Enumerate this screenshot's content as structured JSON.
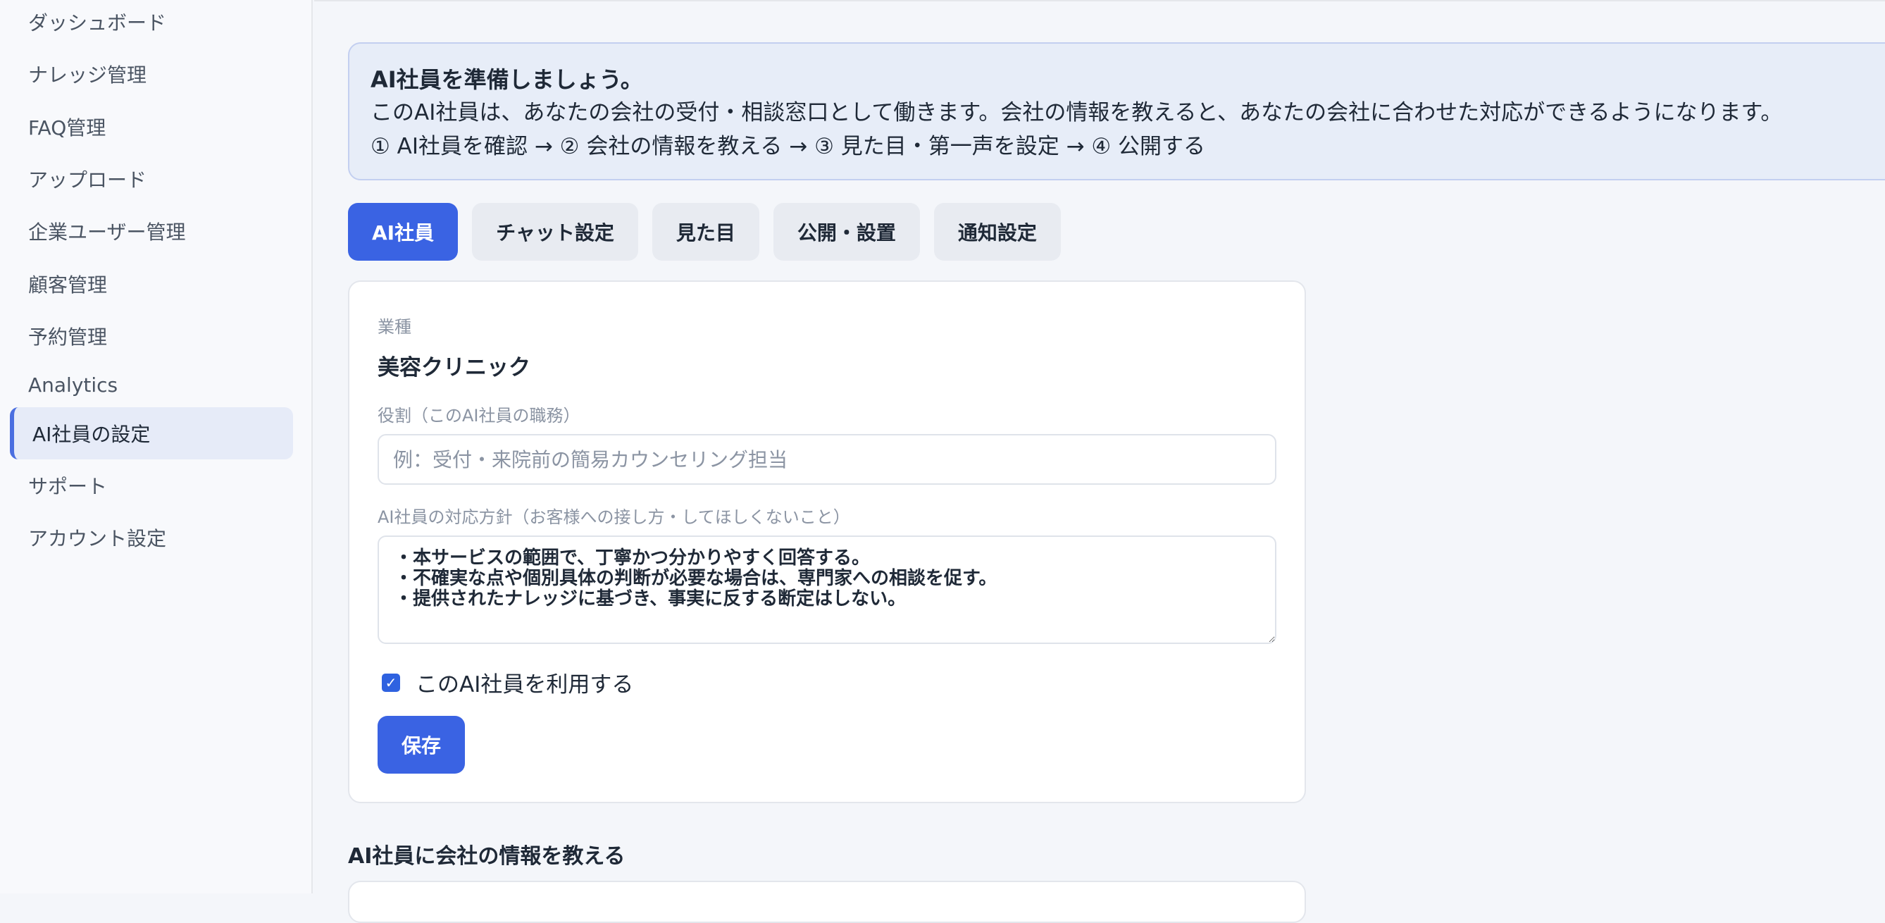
{
  "sidebar": {
    "items": [
      {
        "label": "ダッシュボード"
      },
      {
        "label": "ナレッジ管理"
      },
      {
        "label": "FAQ管理"
      },
      {
        "label": "アップロード"
      },
      {
        "label": "企業ユーザー管理"
      },
      {
        "label": "顧客管理"
      },
      {
        "label": "予約管理"
      },
      {
        "label": "Analytics"
      },
      {
        "label": "AI社員の設定",
        "active": true
      },
      {
        "label": "サポート"
      },
      {
        "label": "アカウント設定"
      }
    ]
  },
  "banner": {
    "title": "AI社員を準備しましょう。",
    "description": "このAI社員は、あなたの会社の受付・相談窓口として働きます。会社の情報を教えると、あなたの会社に合わせた対応ができるようになります。",
    "steps": "① AI社員を確認 → ② 会社の情報を教える → ③ 見た目・第一声を設定 → ④ 公開する"
  },
  "tabs": [
    {
      "label": "AI社員",
      "active": true
    },
    {
      "label": "チャット設定"
    },
    {
      "label": "見た目"
    },
    {
      "label": "公開・設置"
    },
    {
      "label": "通知設定"
    }
  ],
  "form": {
    "industry_label": "業種",
    "industry_value": "美容クリニック",
    "role_label": "役割（このAI社員の職務）",
    "role_value": "",
    "role_placeholder": "例：受付・来院前の簡易カウンセリング担当",
    "policy_label": "AI社員の対応方針（お客様への接し方・してほしくないこと）",
    "policy_value": "・本サービスの範囲で、丁寧かつ分かりやすく回答する。\n・不確実な点や個別具体の判断が必要な場合は、専門家への相談を促す。\n・提供されたナレッジに基づき、事実に反する断定はしない。",
    "enable_label": "このAI社員を利用する",
    "enable_checked": true,
    "save_label": "保存"
  },
  "next_section": {
    "title": "AI社員に会社の情報を教える"
  },
  "colors": {
    "accent": "#3a63e3",
    "banner_bg": "#e7edf8",
    "active_nav_bg": "#e6ebf8"
  }
}
